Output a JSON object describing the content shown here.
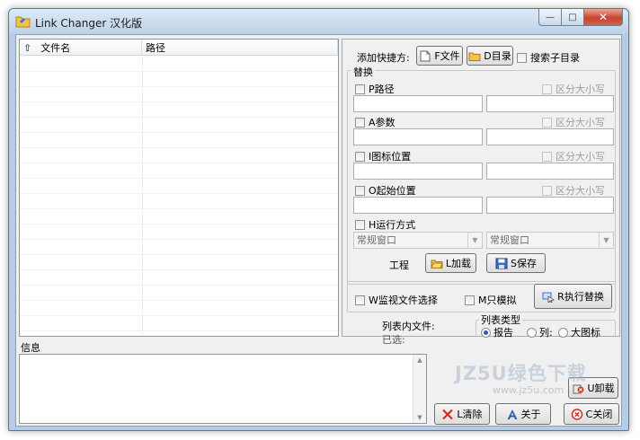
{
  "window": {
    "title": "Link Changer 汉化版",
    "min_glyph": "—",
    "max_glyph": "□",
    "close_glyph": "✕"
  },
  "list": {
    "columns": [
      "文件名",
      "路径"
    ]
  },
  "add_shortcut": {
    "label": "添加快捷方:",
    "file_button": "F文件",
    "dir_button": "D目录",
    "search_subdir": "搜索子目录"
  },
  "replace": {
    "group_title": "替换",
    "rows": [
      {
        "label": "P路径",
        "case_label": "区分大小写"
      },
      {
        "label": "A参数",
        "case_label": "区分大小写"
      },
      {
        "label": "I图标位置",
        "case_label": "区分大小写"
      },
      {
        "label": "O起始位置",
        "case_label": "区分大小写"
      }
    ],
    "run_mode": "H运行方式",
    "combo_left": "常规窗口",
    "combo_right": "常规窗口"
  },
  "project": {
    "label": "工程",
    "load_button": "L加载",
    "save_button": "S保存"
  },
  "options": {
    "monitor_selection": "W监视文件选择",
    "simulate": "M只模拟",
    "execute_button": "R执行替换"
  },
  "list_info": {
    "files_label": "列表内文件:",
    "selected_label": "已选:"
  },
  "list_type": {
    "title": "列表类型",
    "options": [
      "报告",
      "列:",
      "大图标"
    ]
  },
  "info": {
    "label": "信息"
  },
  "bottom_buttons": {
    "uninstall": "U卸载",
    "clear": "L清除",
    "about": "关于",
    "close": "C关闭"
  },
  "watermark": {
    "brand": "JZ5U绿色下载",
    "url": "www.jz5u.com"
  },
  "colors": {
    "accent": "#2d5fa6",
    "close_red": "#c7452e",
    "window_frame": "#b6cce4"
  }
}
